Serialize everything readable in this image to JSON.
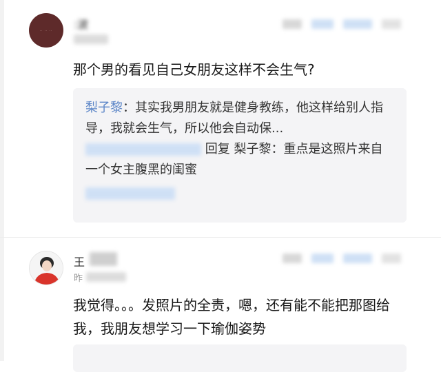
{
  "comments": [
    {
      "username": ":波",
      "text": "那个男的看见自己女朋友这样不会生气?",
      "replies": [
        {
          "author": "梨子黎",
          "text": "：其实我男朋友就是健身教练，他这样给别人指导，我就会生气，所以他会自动保..."
        },
        {
          "prefix": "回复",
          "mention": "梨子黎",
          "text": "：重点是这照片来自一个女主腹黑的闺蜜"
        }
      ]
    },
    {
      "username": "王",
      "time": "昨",
      "text": "我觉得。。。发照片的全责，嗯，还有能不能把那图给我，我朋友想学习一下瑜伽姿势"
    }
  ]
}
